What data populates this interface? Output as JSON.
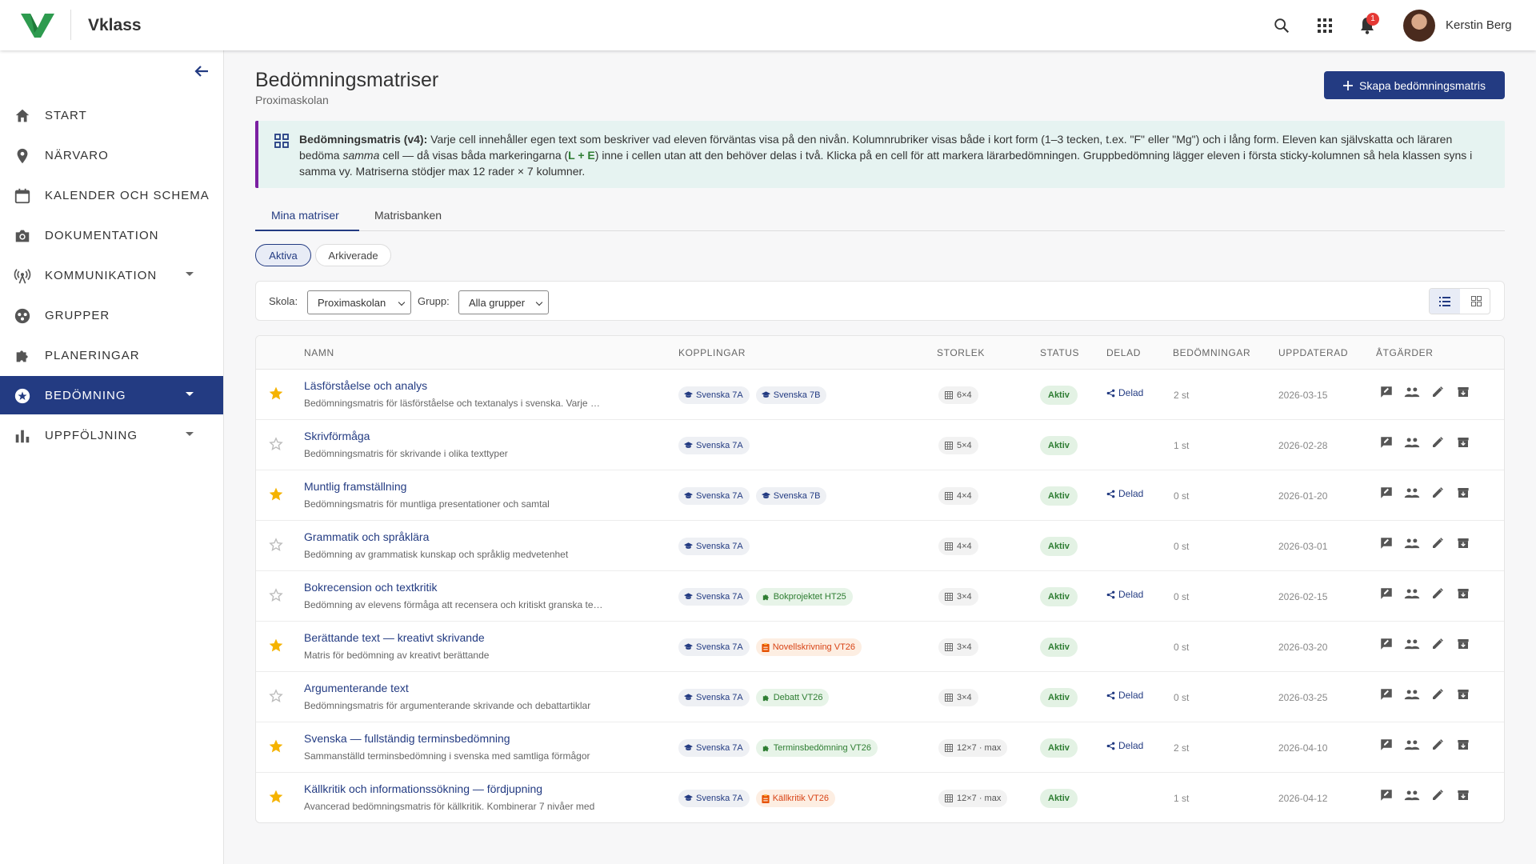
{
  "app": {
    "brand": "Vklass",
    "user_name": "Kerstin Berg",
    "notification_count": "1",
    "brand_color": "#2e9b4f",
    "accent_color": "#233b82"
  },
  "sidebar": {
    "items": [
      {
        "label": "START",
        "icon": "home-icon"
      },
      {
        "label": "NÄRVARO",
        "icon": "location-icon"
      },
      {
        "label": "KALENDER OCH SCHEMA",
        "icon": "calendar-icon"
      },
      {
        "label": "DOKUMENTATION",
        "icon": "camera-icon"
      },
      {
        "label": "KOMMUNIKATION",
        "icon": "broadcast-icon"
      },
      {
        "label": "GRUPPER",
        "icon": "groups-icon"
      },
      {
        "label": "PLANERINGAR",
        "icon": "puzzle-icon"
      },
      {
        "label": "BEDÖMNING",
        "icon": "star-circle-icon",
        "active": true
      },
      {
        "label": "UPPFÖLJNING",
        "icon": "bar-chart-icon"
      }
    ]
  },
  "page": {
    "title": "Bedömningsmatriser",
    "subtitle": "Proximaskolan",
    "create_button": "Skapa bedömningsmatris"
  },
  "info": {
    "heading": "Bedömningsmatris (v4):",
    "text_1": " Varje cell innehåller egen text som beskriver vad eleven förväntas visa på den nivån. Kolumnrubriker visas både i kort form (1–3 tecken, t.ex. \"F\" eller \"Mg\") och i lång form. Eleven kan självskatta och läraren bedöma ",
    "emphasis": "samma",
    "text_2": " cell — då visas båda markeringarna (",
    "markers": "L + E",
    "text_3": ") inne i cellen utan att den behöver delas i två. Klicka på en cell för att markera lärarbedömningen. Gruppbedömning lägger eleven i första sticky-kolumnen så hela klassen syns i samma vy. Matriserna stödjer max 12 rader × 7 kolumner."
  },
  "tabs": [
    "Mina matriser",
    "Matrisbanken"
  ],
  "filters": {
    "status_chips": [
      "Aktiva",
      "Arkiverade"
    ],
    "school_label": "Skola:",
    "school_value": "Proximaskolan",
    "group_label": "Grupp:",
    "group_value": "Alla grupper"
  },
  "table": {
    "headers": [
      "NAMN",
      "KOPPLINGAR",
      "STORLEK",
      "STATUS",
      "DELAD",
      "BEDÖMNINGAR",
      "UPPDATERAD",
      "ÅTGÄRDER"
    ],
    "rows": [
      {
        "starred": true,
        "name": "Läsförståelse och analys",
        "desc": "Bedömningsmatris för läsförståelse och textanalys i svenska. Varje nivå beskriver elevens förmåga",
        "links": [
          {
            "type": "group",
            "label": "Svenska 7A"
          },
          {
            "type": "group",
            "label": "Svenska 7B"
          }
        ],
        "size": "6×4",
        "status": "Aktiv",
        "shared": "Delad",
        "count": "2 st",
        "updated": "2026-03-15"
      },
      {
        "starred": false,
        "name": "Skrivförmåga",
        "desc": "Bedömningsmatris för skrivande i olika texttyper",
        "links": [
          {
            "type": "group",
            "label": "Svenska 7A"
          }
        ],
        "size": "5×4",
        "status": "Aktiv",
        "shared": "",
        "count": "1 st",
        "updated": "2026-02-28"
      },
      {
        "starred": true,
        "name": "Muntlig framställning",
        "desc": "Bedömningsmatris för muntliga presentationer och samtal",
        "links": [
          {
            "type": "group",
            "label": "Svenska 7A"
          },
          {
            "type": "group",
            "label": "Svenska 7B"
          }
        ],
        "size": "4×4",
        "status": "Aktiv",
        "shared": "Delad",
        "count": "0 st",
        "updated": "2026-01-20"
      },
      {
        "starred": false,
        "name": "Grammatik och språklära",
        "desc": "Bedömning av grammatisk kunskap och språklig medvetenhet",
        "links": [
          {
            "type": "group",
            "label": "Svenska 7A"
          }
        ],
        "size": "4×4",
        "status": "Aktiv",
        "shared": "",
        "count": "0 st",
        "updated": "2026-03-01"
      },
      {
        "starred": false,
        "name": "Bokrecension och textkritik",
        "desc": "Bedömning av elevens förmåga att recensera och kritiskt granska texter",
        "links": [
          {
            "type": "group",
            "label": "Svenska 7A"
          },
          {
            "type": "planning",
            "label": "Bokprojektet HT25"
          }
        ],
        "size": "3×4",
        "status": "Aktiv",
        "shared": "Delad",
        "count": "0 st",
        "updated": "2026-02-15"
      },
      {
        "starred": true,
        "name": "Berättande text — kreativt skrivande",
        "desc": "Matris för bedömning av kreativt berättande",
        "links": [
          {
            "type": "group",
            "label": "Svenska 7A"
          },
          {
            "type": "task",
            "label": "Novellskrivning VT26"
          }
        ],
        "size": "3×4",
        "status": "Aktiv",
        "shared": "",
        "count": "0 st",
        "updated": "2026-03-20"
      },
      {
        "starred": false,
        "name": "Argumenterande text",
        "desc": "Bedömningsmatris för argumenterande skrivande och debattartiklar",
        "links": [
          {
            "type": "group",
            "label": "Svenska 7A"
          },
          {
            "type": "planning",
            "label": "Debatt VT26"
          }
        ],
        "size": "3×4",
        "status": "Aktiv",
        "shared": "Delad",
        "count": "0 st",
        "updated": "2026-03-25"
      },
      {
        "starred": true,
        "name": "Svenska — fullständig terminsbedömning",
        "desc": "Sammanställd terminsbedömning i svenska med samtliga förmågor",
        "links": [
          {
            "type": "group",
            "label": "Svenska 7A"
          },
          {
            "type": "planning",
            "label": "Terminsbedömning VT26"
          }
        ],
        "size": "12×7 · max",
        "status": "Aktiv",
        "shared": "Delad",
        "count": "2 st",
        "updated": "2026-04-10"
      },
      {
        "starred": true,
        "name": "Källkritik och informationssökning — fördjupning",
        "desc": "Avancerad bedömningsmatris för källkritik. Kombinerar 7 nivåer med",
        "links": [
          {
            "type": "group",
            "label": "Svenska 7A"
          },
          {
            "type": "task",
            "label": "Källkritik VT26"
          }
        ],
        "size": "12×7 · max",
        "status": "Aktiv",
        "shared": "",
        "count": "1 st",
        "updated": "2026-04-12"
      }
    ]
  }
}
